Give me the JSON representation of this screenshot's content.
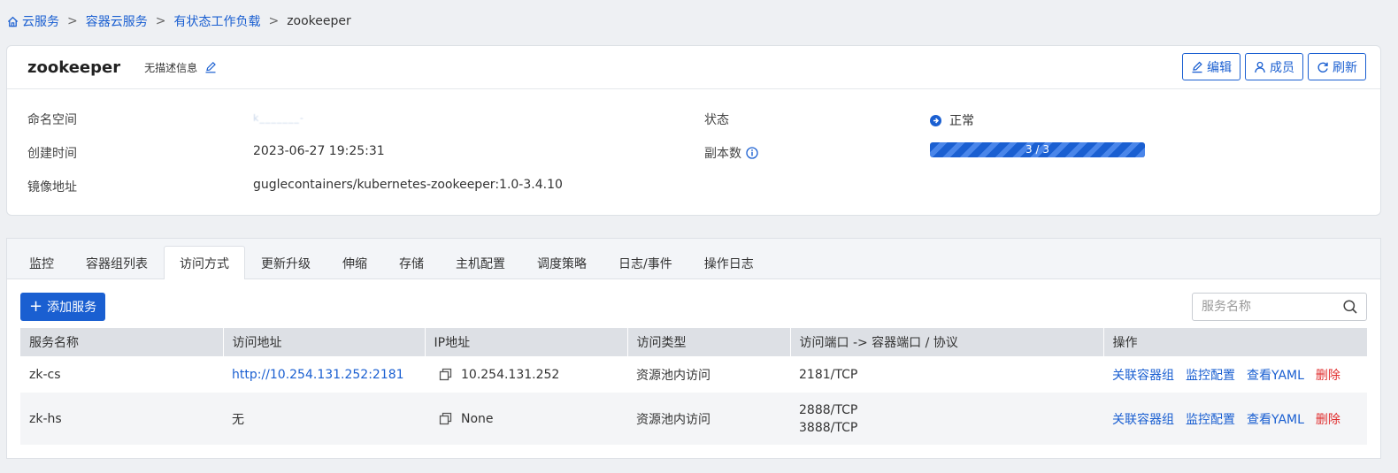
{
  "breadcrumb": {
    "items": [
      {
        "label": "云服务"
      },
      {
        "label": "容器云服务"
      },
      {
        "label": "有状态工作负载"
      }
    ],
    "separator": ">",
    "current": "zookeeper"
  },
  "app": {
    "name": "zookeeper",
    "description": "无描述信息",
    "actions": {
      "edit": "编辑",
      "members": "成员",
      "refresh": "刷新"
    }
  },
  "info": {
    "namespace_label": "命名空间",
    "namespace_value": "k_______-",
    "created_label": "创建时间",
    "created_value": "2023-06-27 19:25:31",
    "image_label": "镜像地址",
    "image_value": "guglecontainers/kubernetes-zookeeper:1.0-3.4.10",
    "status_label": "状态",
    "status_value": "正常",
    "replicas_label": "副本数",
    "replicas_text": "3 / 3",
    "replicas_ready": 3,
    "replicas_total": 3
  },
  "tabs": [
    {
      "label": "监控"
    },
    {
      "label": "容器组列表"
    },
    {
      "label": "访问方式",
      "active": true
    },
    {
      "label": "更新升级"
    },
    {
      "label": "伸缩"
    },
    {
      "label": "存储"
    },
    {
      "label": "主机配置"
    },
    {
      "label": "调度策略"
    },
    {
      "label": "日志/事件"
    },
    {
      "label": "操作日志"
    }
  ],
  "services": {
    "add_button": "添加服务",
    "search_placeholder": "服务名称",
    "columns": [
      "服务名称",
      "访问地址",
      "IP地址",
      "访问类型",
      "访问端口 -> 容器端口 / 协议",
      "操作"
    ],
    "rows": [
      {
        "name": "zk-cs",
        "address": "http://10.254.131.252:2181",
        "address_is_link": true,
        "ip": "10.254.131.252",
        "type": "资源池内访问",
        "ports": [
          "2181/TCP"
        ]
      },
      {
        "name": "zk-hs",
        "address": "无",
        "address_is_link": false,
        "ip": "None",
        "type": "资源池内访问",
        "ports": [
          "2888/TCP",
          "3888/TCP"
        ]
      }
    ],
    "row_actions": {
      "link_pods": "关联容器组",
      "monitor_config": "监控配置",
      "view_yaml": "查看YAML",
      "delete": "删除"
    }
  },
  "colors": {
    "primary": "#1a5fd1",
    "danger": "#e02d2d",
    "header_bg": "#dde0e5"
  }
}
